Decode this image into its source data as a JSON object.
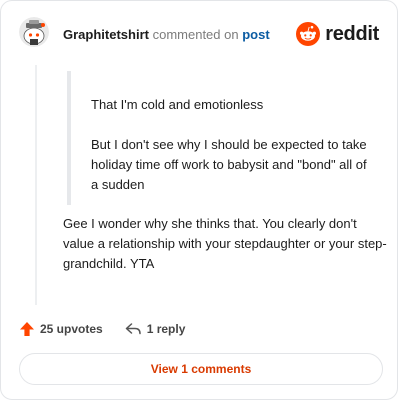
{
  "comment": {
    "username": "Graphitetshirt",
    "action_text": "commented on",
    "post_link": "post",
    "quoted_paragraphs": [
      "That I'm cold and emotionless",
      "But I don't see why I should be expected to take holiday time off work to babysit and \"bond\" all of a sudden"
    ],
    "body": "Gee I wonder why she thinks that. You clearly don't value a relationship with your stepdaughter or your step-grandchild. YTA"
  },
  "brand": {
    "name": "reddit",
    "color": "#ff4500"
  },
  "actions": {
    "upvotes": "25 upvotes",
    "replies": "1 reply"
  },
  "footer": {
    "view_comments_label": "View 1 comments"
  },
  "colors": {
    "accent": "#d93a00",
    "upvote": "#ff4500",
    "link": "#0b5ca3"
  }
}
